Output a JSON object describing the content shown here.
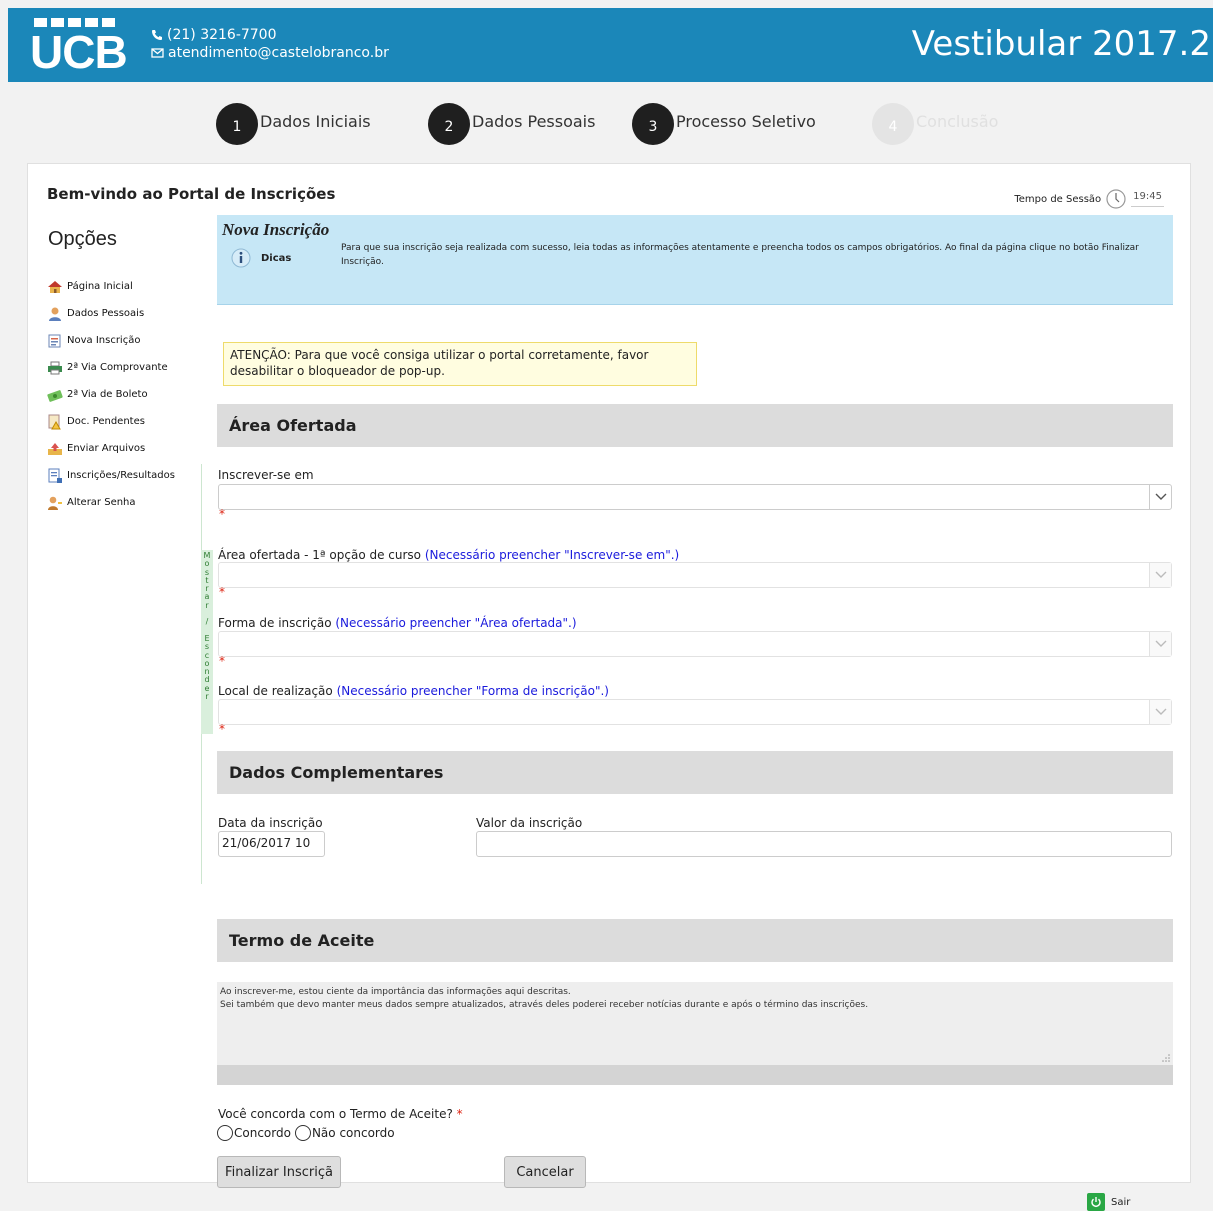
{
  "header": {
    "logo_text": "UCB",
    "phone": "(21) 3216-7700",
    "email": "atendimento@castelobranco.br",
    "title": "Vestibular 2017.2",
    "bg_color": "#1b87b9"
  },
  "steps": [
    {
      "num": "1",
      "label": "Dados Iniciais",
      "active": true
    },
    {
      "num": "2",
      "label": "Dados Pessoais",
      "active": true
    },
    {
      "num": "3",
      "label": "Processo Seletivo",
      "active": true
    },
    {
      "num": "4",
      "label": "Conclusão",
      "active": false
    }
  ],
  "welcome": "Bem-vindo ao Portal de Inscrições",
  "session": {
    "label": "Tempo de Sessão",
    "time": "19:45"
  },
  "sidebar": {
    "title": "Opções",
    "items": [
      {
        "label": "Página Inicial",
        "icon": "home-icon"
      },
      {
        "label": "Dados Pessoais",
        "icon": "user-icon"
      },
      {
        "label": "Nova Inscrição",
        "icon": "form-icon"
      },
      {
        "label": "2ª Via Comprovante",
        "icon": "printer-icon"
      },
      {
        "label": "2ª Via de Boleto",
        "icon": "money-icon"
      },
      {
        "label": "Doc. Pendentes",
        "icon": "warning-doc-icon"
      },
      {
        "label": "Enviar Arquivos",
        "icon": "upload-icon"
      },
      {
        "label": "Inscrições/Resultados",
        "icon": "list-icon"
      },
      {
        "label": "Alterar Senha",
        "icon": "key-user-icon"
      }
    ],
    "toggle_label": "Mostrar / Esconder"
  },
  "tip": {
    "title": "Nova Inscrição",
    "dicas": "Dicas",
    "text": "Para que sua inscrição seja realizada com sucesso, leia todas as informações atentamente e preencha todos os campos obrigatórios. Ao final da página clique no botão Finalizar Inscrição."
  },
  "warning": "ATENÇÃO: Para que você consiga utilizar o portal corretamente, favor desabilitar o bloqueador de pop-up.",
  "sections": {
    "area": "Área Ofertada",
    "complementares": "Dados Complementares",
    "termo": "Termo de Aceite"
  },
  "fields": {
    "inscrever": {
      "label": "Inscrever-se em",
      "hint": ""
    },
    "area": {
      "label": "Área ofertada - 1ª opção de curso ",
      "hint": "(Necessário preencher \"Inscrever-se em\".)"
    },
    "forma": {
      "label": "Forma de inscrição ",
      "hint": "(Necessário preencher \"Área ofertada\".)"
    },
    "local": {
      "label": "Local de realização ",
      "hint": "(Necessário preencher \"Forma de inscrição\".)"
    },
    "required_mark": "*",
    "data_label": "Data da inscrição",
    "data_value": "21/06/2017 10",
    "valor_label": "Valor da inscrição",
    "valor_value": ""
  },
  "terms": {
    "line1": "Ao inscrever-me, estou ciente da importância das informações aqui descritas.",
    "line2": "Sei também que devo manter meus dados sempre atualizados, através deles poderei receber notícias durante e após o término das inscrições."
  },
  "agreement": {
    "question": "Você concorda com o Termo de Aceite?",
    "star": "*",
    "option_yes": "Concordo",
    "option_no": "Não concordo"
  },
  "buttons": {
    "finalizar": "Finalizar Inscriçã",
    "cancelar": "Cancelar",
    "sair": "Sair"
  }
}
